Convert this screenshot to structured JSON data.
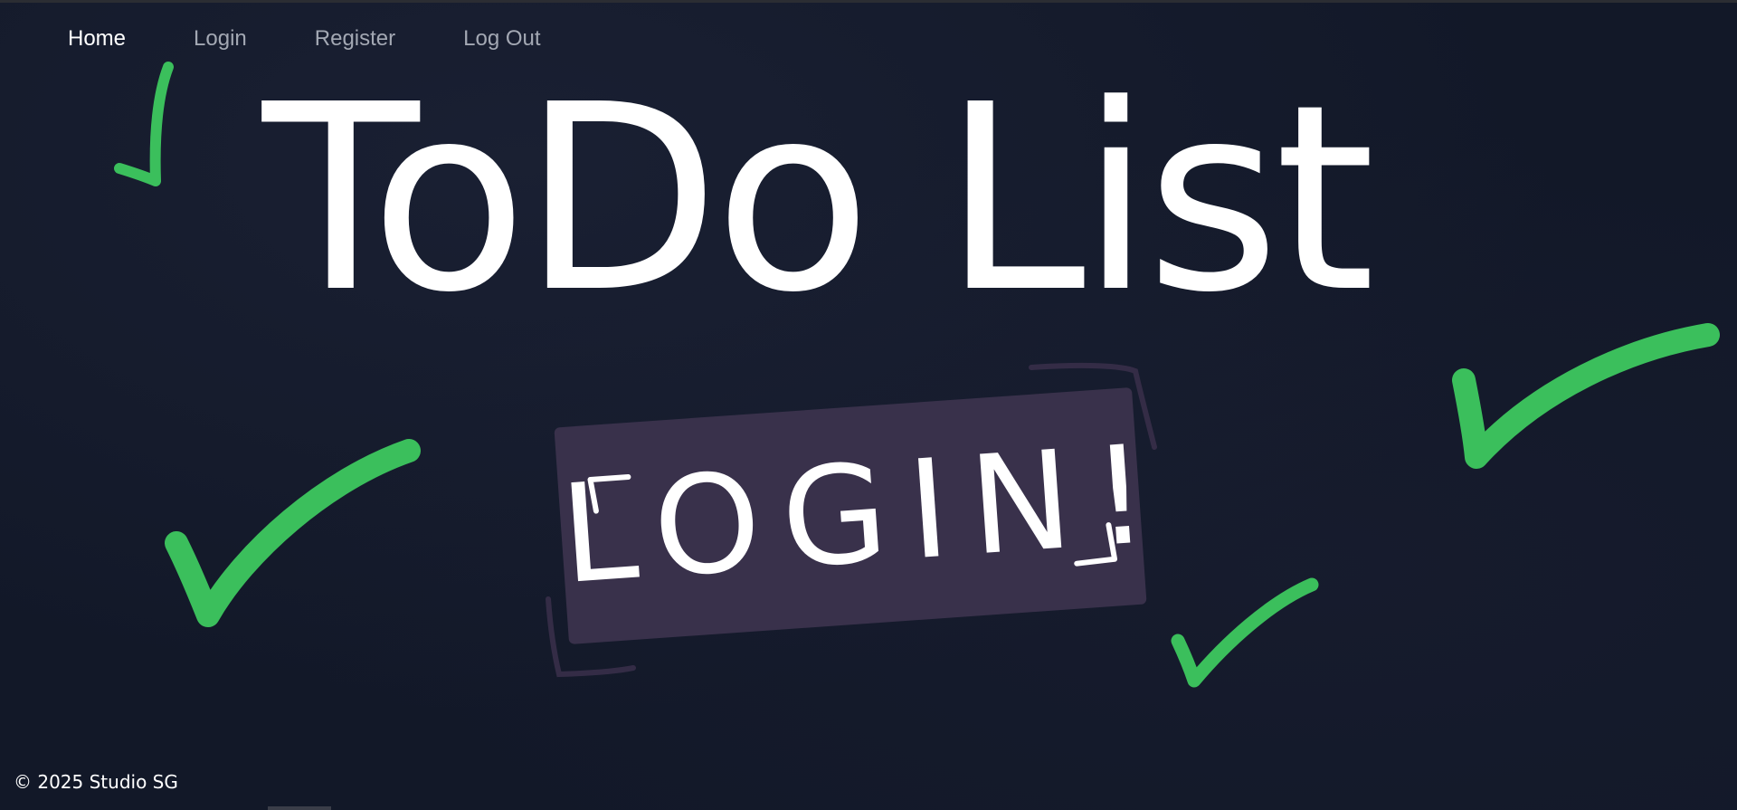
{
  "nav": {
    "items": [
      {
        "label": "Home",
        "active": true
      },
      {
        "label": "Login",
        "active": false
      },
      {
        "label": "Register",
        "active": false
      },
      {
        "label": "Log Out",
        "active": false
      }
    ]
  },
  "hero": {
    "title": "ToDo List",
    "login_tag": "LOGIN!"
  },
  "footer": {
    "copyright": "© 2025 Studio SG"
  },
  "colors": {
    "background": "#121828",
    "checkmark": "#3bbf5c",
    "login_plate": "#39314b",
    "nav_active": "#ffffff",
    "nav_inactive": "#a3a8b3"
  },
  "icons": [
    "checkmark-icon"
  ]
}
